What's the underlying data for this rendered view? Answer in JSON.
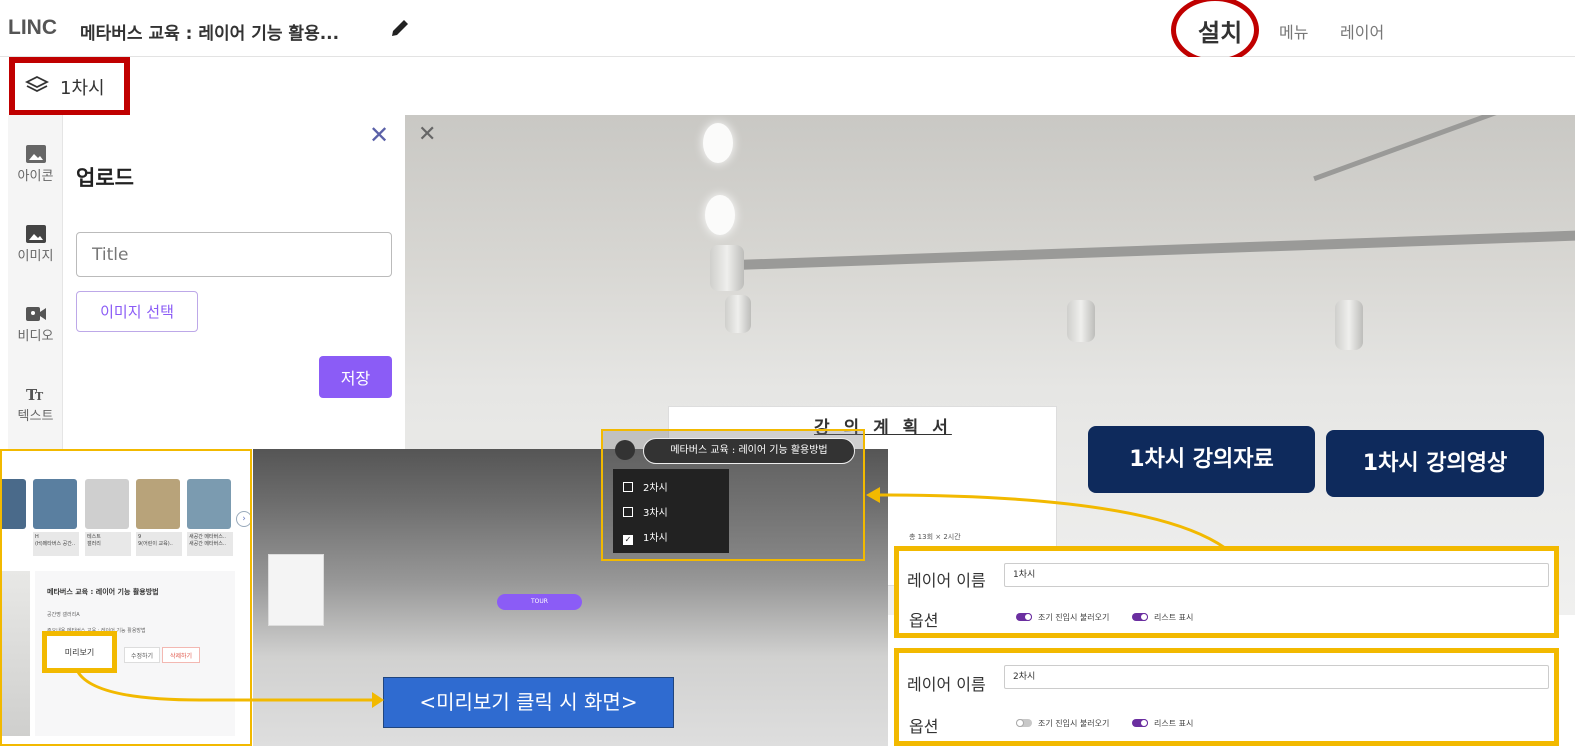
{
  "app": {
    "logo": "LINC",
    "title": "메타버스 교육 : 레이어 기능 활용..."
  },
  "nav": {
    "install": "설치",
    "menu": "메뉴",
    "layer": "레이어"
  },
  "current_layer": {
    "name": "1차시",
    "icon": "layers-icon"
  },
  "sidebar": {
    "items": [
      {
        "label": "아이콘",
        "icon": "image-icon"
      },
      {
        "label": "이미지",
        "icon": "image-icon"
      },
      {
        "label": "비디오",
        "icon": "video-icon"
      },
      {
        "label": "텍스트",
        "icon": "text-icon"
      }
    ]
  },
  "upload": {
    "title": "업로드",
    "title_placeholder": "Title",
    "select_image_label": "이미지 선택",
    "save_label": "저장"
  },
  "viewer": {
    "wall_doc_title": "강 의 계 획 서",
    "wall_doc_line": "총 13회 × 2시간",
    "buttons": [
      "1차시 강의자료",
      "1차시 강의영상"
    ]
  },
  "preview_list": {
    "thumbnails": [
      {
        "name": "H",
        "sub": "(H)메타버스 공간.."
      },
      {
        "name": "테스트",
        "sub": "갤러리"
      },
      {
        "name": "9",
        "sub": "9(어린이 교육).."
      },
      {
        "name": "새공간 메타버스..",
        "sub": "새공간 메타버스.."
      }
    ],
    "info_title": "메타버스 교육 : 레이어 기능 활용방법",
    "info_rows": [
      "공간명   갤러리A",
      "주요내용   메타버스 교육 : 레이어 기능 활용방법"
    ],
    "preview_label": "미리보기",
    "edit_label": "수정하기",
    "delete_label": "삭제하기"
  },
  "preview_scene": {
    "tour_label": "TOUR"
  },
  "layer_popup": {
    "title": "메타버스 교육 : 레이어 기능 활용방법",
    "items": [
      {
        "label": "2차시",
        "checked": false
      },
      {
        "label": "3차시",
        "checked": false
      },
      {
        "label": "1차시",
        "checked": true
      }
    ]
  },
  "caption": "<미리보기 클릭 시 화면>",
  "layer_settings": [
    {
      "name_label": "레이어 이름",
      "name_value": "1차시",
      "options_label": "옵션",
      "option1": "조기 진입시 불러오기",
      "option1_on": true,
      "option2": "리스트 표시",
      "option2_on": true
    },
    {
      "name_label": "레이어 이름",
      "name_value": "2차시",
      "options_label": "옵션",
      "option1": "조기 진입시 불러오기",
      "option1_on": false,
      "option2": "리스트 표시",
      "option2_on": true
    }
  ],
  "colors": {
    "annotation_red": "#c00000",
    "annotation_yellow": "#f2b900",
    "accent_purple": "#8b5cf6",
    "lecture_navy": "#0e2a5c",
    "caption_blue": "#2f6bd0"
  }
}
